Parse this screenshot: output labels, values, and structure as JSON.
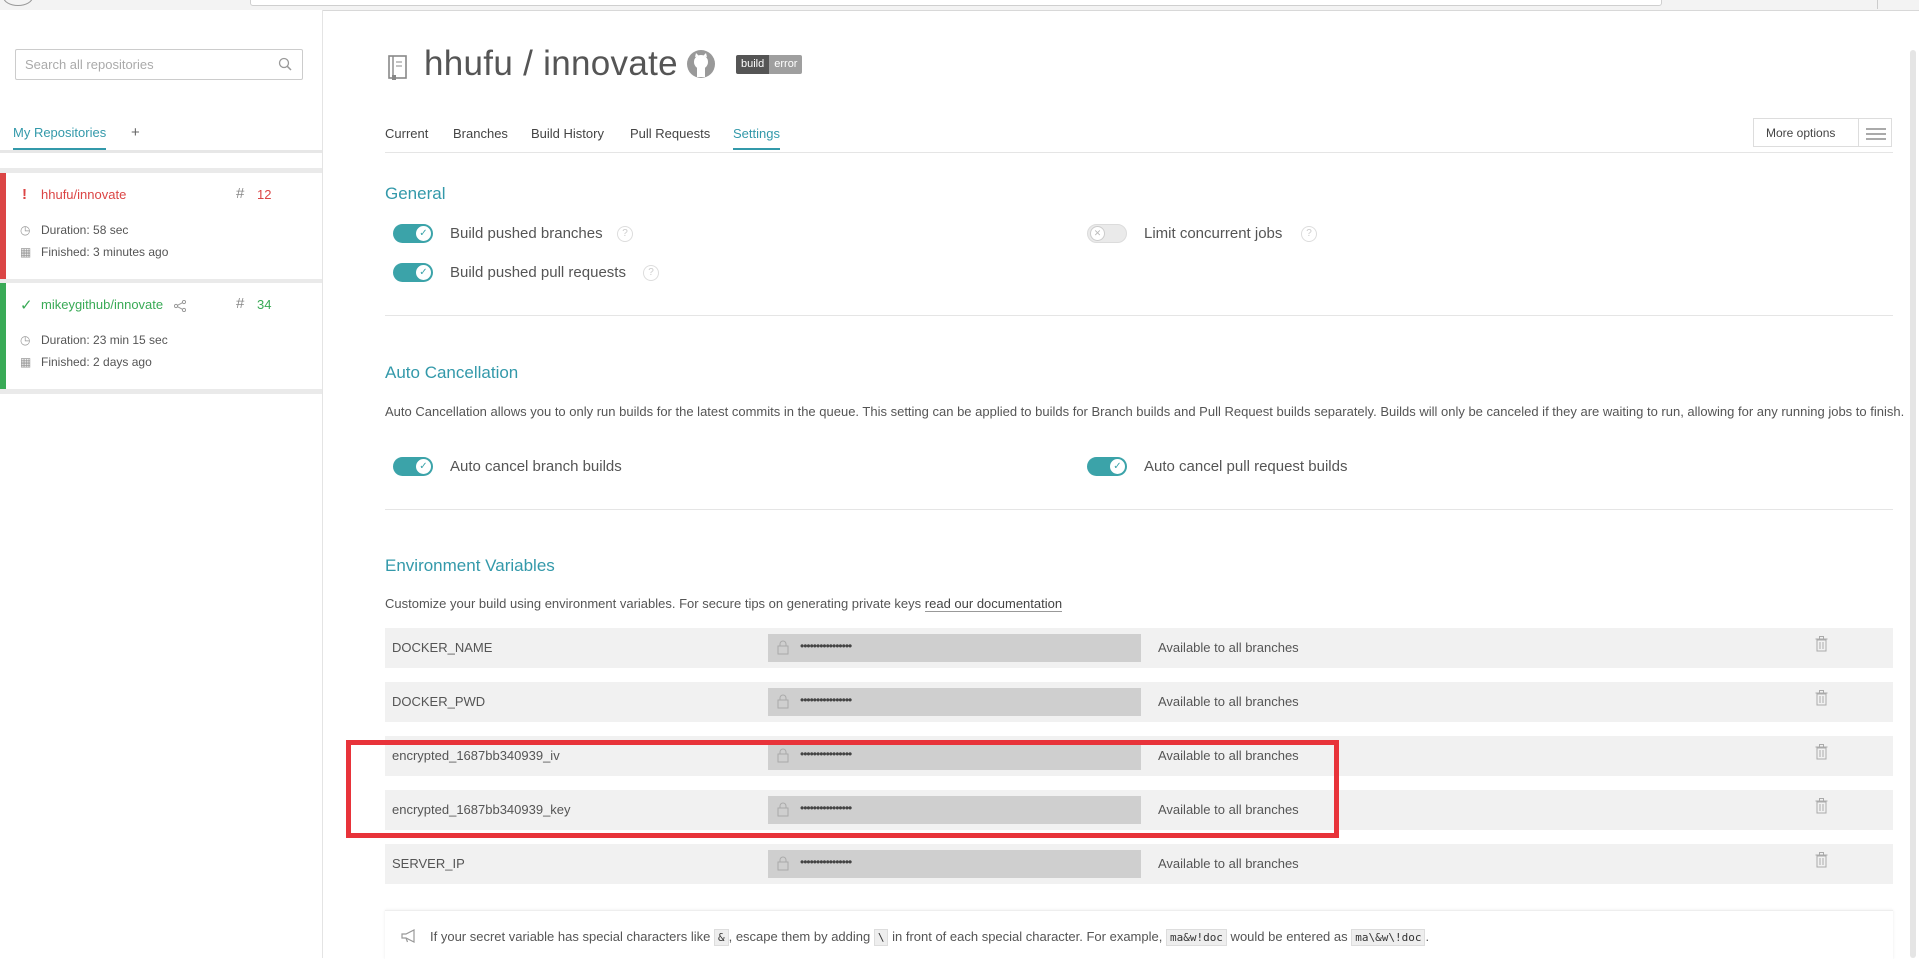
{
  "search": {
    "placeholder": "Search all repositories"
  },
  "sidebar": {
    "tabs": {
      "my_repositories": "My Repositories",
      "add": "+"
    },
    "repos": [
      {
        "name": "hhufu/innovate",
        "build_number": "12",
        "duration": "Duration: 58 sec",
        "finished": "Finished: 3 minutes ago",
        "status": "error",
        "status_color": "#db4545"
      },
      {
        "name": "mikeygithub/innovate",
        "build_number": "34",
        "duration": "Duration: 23 min 15 sec",
        "finished": "Finished: 2 days ago",
        "status": "passed",
        "status_color": "#39aa56"
      }
    ]
  },
  "header": {
    "title": "hhufu / innovate",
    "badge_left": "build",
    "badge_right": "error"
  },
  "nav": {
    "current": "Current",
    "branches": "Branches",
    "build_history": "Build History",
    "pull_requests": "Pull Requests",
    "settings": "Settings",
    "more_options": "More options"
  },
  "general": {
    "title": "General",
    "build_pushed_branches": {
      "label": "Build pushed branches",
      "enabled": true
    },
    "build_pushed_prs": {
      "label": "Build pushed pull requests",
      "enabled": true
    },
    "limit_concurrent": {
      "label": "Limit concurrent jobs",
      "enabled": false
    }
  },
  "auto_cancellation": {
    "title": "Auto Cancellation",
    "description": "Auto Cancellation allows you to only run builds for the latest commits in the queue. This setting can be applied to builds for Branch builds and Pull Request builds separately. Builds will only be canceled if they are waiting to run, allowing for any running jobs to finish.",
    "branch": {
      "label": "Auto cancel branch builds",
      "enabled": true
    },
    "pr": {
      "label": "Auto cancel pull request builds",
      "enabled": true
    }
  },
  "env_vars": {
    "title": "Environment Variables",
    "description": "Customize your build using environment variables. For secure tips on generating private keys ",
    "doc_link": "read our documentation",
    "rows": [
      {
        "name": "DOCKER_NAME",
        "value": "••••••••••••••••",
        "scope": "Available to all branches"
      },
      {
        "name": "DOCKER_PWD",
        "value": "••••••••••••••••",
        "scope": "Available to all branches"
      },
      {
        "name": "encrypted_1687bb340939_iv",
        "value": "••••••••••••••••",
        "scope": "Available to all branches"
      },
      {
        "name": "encrypted_1687bb340939_key",
        "value": "••••••••••••••••",
        "scope": "Available to all branches"
      },
      {
        "name": "SERVER_IP",
        "value": "••••••••••••••••",
        "scope": "Available to all branches"
      }
    ]
  },
  "note": {
    "t1": "If your secret variable has special characters like ",
    "c1": "&",
    "t2": ", escape them by adding ",
    "c2": "\\",
    "t3": " in front of each special character. For example, ",
    "c3": "ma&w!doc",
    "t4": " would be entered as ",
    "c4": "ma\\&w\\!doc",
    "t5": "."
  },
  "colors": {
    "accent": "#39a9ad",
    "error": "#db4545",
    "passed": "#39aa56",
    "highlight": "#e8333a"
  }
}
